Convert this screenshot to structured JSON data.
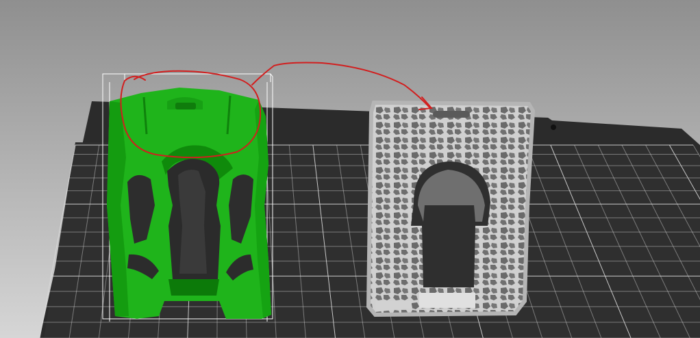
{
  "viewport": {
    "background_top": "#8f8f8f",
    "background_bottom": "#d2d2d2",
    "bed_color": "#2a2a2a",
    "grid_color": "#e6e6e6"
  },
  "objects": [
    {
      "id": "green-case",
      "state": "selected",
      "color": "#1fc01f",
      "shade": "#13880f"
    },
    {
      "id": "gray-voronoi-case",
      "state": "unselected",
      "color": "#c9c9c9",
      "shade": "#8d8d8d"
    }
  ],
  "annotation": {
    "stroke": "#d32020",
    "shapes": [
      "circle-around-top",
      "arrow-to-other-object"
    ]
  }
}
